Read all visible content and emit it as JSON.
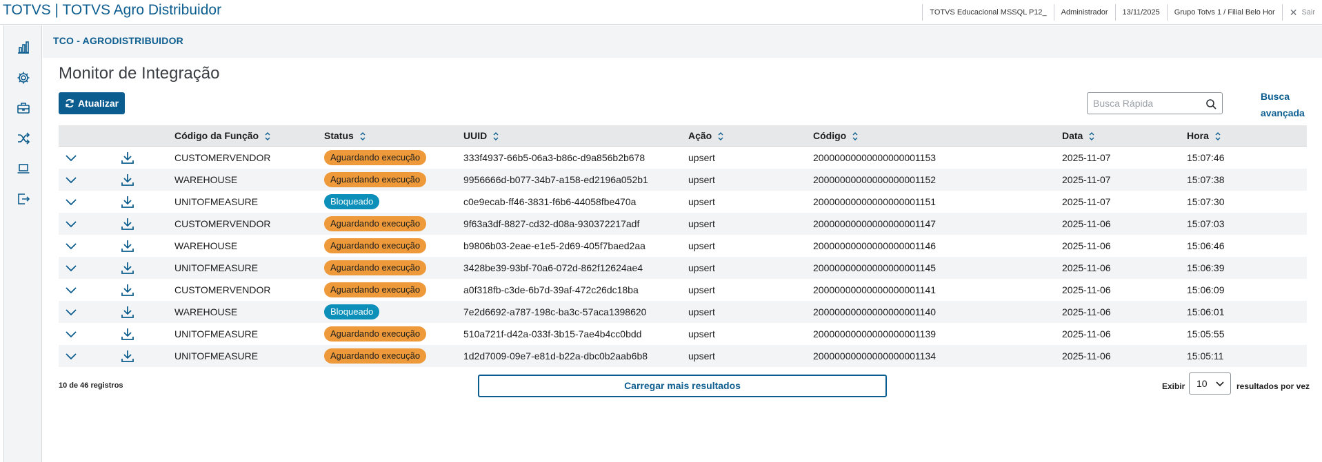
{
  "app": {
    "title": "TOTVS | TOTVS Agro Distribuidor"
  },
  "top_info": {
    "environment": "TOTVS Educacional MSSQL P12_",
    "user": "Administrador",
    "date": "13/11/2025",
    "branch": "Grupo Totvs 1 / Filial Belo Hor",
    "exit_label": "Sair"
  },
  "sidebar": {
    "items": [
      {
        "icon": "bar-chart-icon"
      },
      {
        "icon": "gear-icon"
      },
      {
        "icon": "briefcase-icon"
      },
      {
        "icon": "shuffle-icon"
      },
      {
        "icon": "laptop-icon"
      },
      {
        "icon": "logout-icon"
      }
    ]
  },
  "breadcrumb": "TCO - AGRODISTRIBUIDOR",
  "page": {
    "title": "Monitor de Integração",
    "refresh_label": "Atualizar",
    "search_placeholder": "Busca Rápida",
    "advanced_search": "Busca avançada"
  },
  "table": {
    "columns": [
      "Código da Função",
      "Status",
      "UUID",
      "Ação",
      "Código",
      "Data",
      "Hora"
    ],
    "rows": [
      {
        "function": "CUSTOMERVENDOR",
        "status": "Aguardando execução",
        "status_type": "wait",
        "uuid": "333f4937-66b5-06a3-b86c-d9a856b2b678",
        "action": "upsert",
        "code": "20000000000000000001153",
        "date": "2025-11-07",
        "time": "15:07:46"
      },
      {
        "function": "WAREHOUSE",
        "status": "Aguardando execução",
        "status_type": "wait",
        "uuid": "9956666d-b077-34b7-a158-ed2196a052b1",
        "action": "upsert",
        "code": "20000000000000000001152",
        "date": "2025-11-07",
        "time": "15:07:38"
      },
      {
        "function": "UNITOFMEASURE",
        "status": "Bloqueado",
        "status_type": "block",
        "uuid": "c0e9ecab-ff46-3831-f6b6-44058fbe470a",
        "action": "upsert",
        "code": "20000000000000000001151",
        "date": "2025-11-07",
        "time": "15:07:30"
      },
      {
        "function": "CUSTOMERVENDOR",
        "status": "Aguardando execução",
        "status_type": "wait",
        "uuid": "9f63a3df-8827-cd32-d08a-930372217adf",
        "action": "upsert",
        "code": "20000000000000000001147",
        "date": "2025-11-06",
        "time": "15:07:03"
      },
      {
        "function": "WAREHOUSE",
        "status": "Aguardando execução",
        "status_type": "wait",
        "uuid": "b9806b03-2eae-e1e5-2d69-405f7baed2aa",
        "action": "upsert",
        "code": "20000000000000000001146",
        "date": "2025-11-06",
        "time": "15:06:46"
      },
      {
        "function": "UNITOFMEASURE",
        "status": "Aguardando execução",
        "status_type": "wait",
        "uuid": "3428be39-93bf-70a6-072d-862f12624ae4",
        "action": "upsert",
        "code": "20000000000000000001145",
        "date": "2025-11-06",
        "time": "15:06:39"
      },
      {
        "function": "CUSTOMERVENDOR",
        "status": "Aguardando execução",
        "status_type": "wait",
        "uuid": "a0f318fb-c3de-6b7d-39af-472c26dc18ba",
        "action": "upsert",
        "code": "20000000000000000001141",
        "date": "2025-11-06",
        "time": "15:06:09"
      },
      {
        "function": "WAREHOUSE",
        "status": "Bloqueado",
        "status_type": "block",
        "uuid": "7e2d6692-a787-198c-ba3c-57aca1398620",
        "action": "upsert",
        "code": "20000000000000000001140",
        "date": "2025-11-06",
        "time": "15:06:01"
      },
      {
        "function": "UNITOFMEASURE",
        "status": "Aguardando execução",
        "status_type": "wait",
        "uuid": "510a721f-d42a-033f-3b15-7ae4b4cc0bdd",
        "action": "upsert",
        "code": "20000000000000000001139",
        "date": "2025-11-06",
        "time": "15:05:55"
      },
      {
        "function": "UNITOFMEASURE",
        "status": "Aguardando execução",
        "status_type": "wait",
        "uuid": "1d2d7009-09e7-e81d-b22a-dbc0b2aab6b8",
        "action": "upsert",
        "code": "20000000000000000001134",
        "date": "2025-11-06",
        "time": "15:05:11"
      }
    ]
  },
  "footer": {
    "count": "10 de 46 registros",
    "load_more": "Carregar mais resultados",
    "show_label": "Exibir",
    "page_size": "10",
    "per_label": "resultados por vez"
  },
  "colors": {
    "primary": "#0c5d8f",
    "status_wait": "#ee9a3a",
    "status_block": "#0c8fb8"
  }
}
